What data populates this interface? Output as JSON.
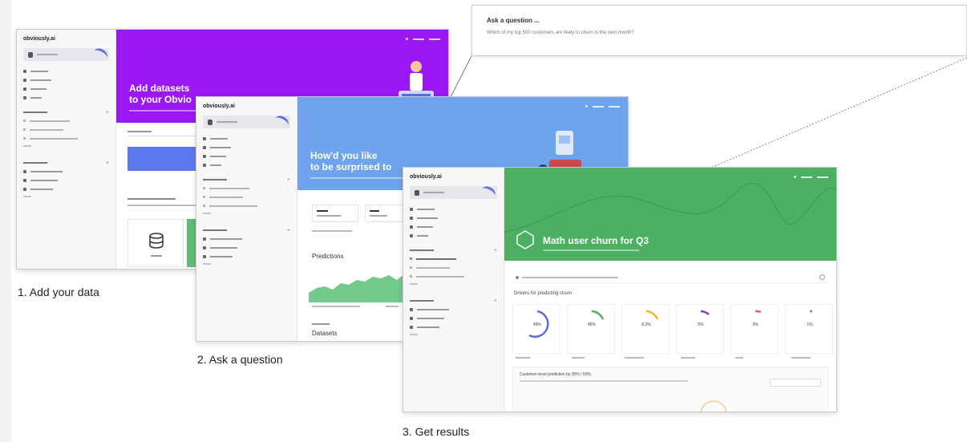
{
  "callout": {
    "title": "Ask a question ...",
    "text": "Which of my top 500 customers are likely to churn in the next month?"
  },
  "window1": {
    "logo": "obviously.ai",
    "hero_title_1": "Add datasets",
    "hero_title_2": "to your Obvio",
    "hero_color": "#9b18f2"
  },
  "window2": {
    "logo": "obviously.ai",
    "hero_title_1": "How'd you like",
    "hero_title_2": "to be surprised to",
    "hero_color": "#6ea3ee",
    "section_label": "Predictions",
    "section_label_2": "Datasets"
  },
  "window3": {
    "logo": "obviously.ai",
    "hero_title": "Math user churn for Q3",
    "hero_color": "#4caf62",
    "section_label": "Drivers for predicting churn",
    "gauges": [
      "49%",
      "45%",
      "8.2%",
      "5%",
      "3%",
      "1%"
    ],
    "panel_title": "Customer-level prediction by 30% / 50%"
  },
  "captions": {
    "step1": "1. Add your data",
    "step2": "2. Ask a question",
    "step3": "3. Get results"
  },
  "colors": {
    "purple": "#9b18f2",
    "blue": "#6ea3ee",
    "green": "#4caf62",
    "accent_indigo": "#5a6ee0"
  }
}
